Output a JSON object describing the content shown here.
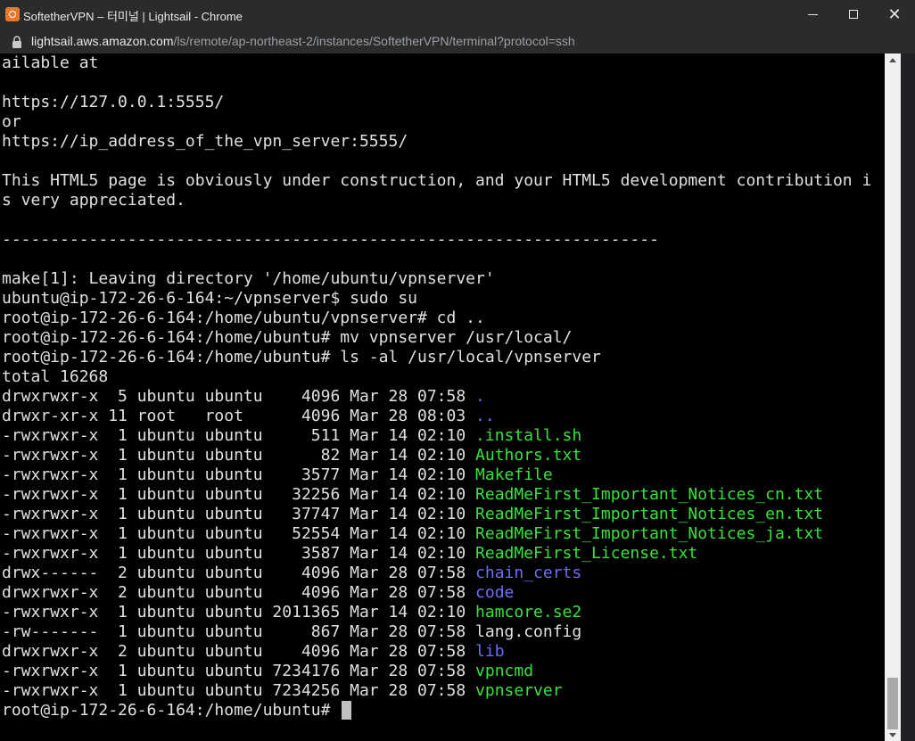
{
  "window": {
    "title": "SoftetherVPN – 터미널 | Lightsail - Chrome",
    "minimize_icon": "minimize-icon",
    "maximize_icon": "maximize-icon",
    "close_symbol": "✕"
  },
  "address": {
    "host": "lightsail.aws.amazon.com",
    "path": "/ls/remote/ap-northeast-2/instances/SoftetherVPN/terminal?protocol=ssh"
  },
  "terminal": {
    "lines": [
      "ailable at",
      "",
      "https://127.0.0.1:5555/",
      "or",
      "https://ip_address_of_the_vpn_server:5555/",
      "",
      "This HTML5 page is obviously under construction, and your HTML5 development contribution i",
      "s very appreciated.",
      "",
      "--------------------------------------------------------------------",
      "",
      "make[1]: Leaving directory '/home/ubuntu/vpnserver'",
      "ubuntu@ip-172-26-6-164:~/vpnserver$ sudo su",
      "root@ip-172-26-6-164:/home/ubuntu/vpnserver# cd ..",
      "root@ip-172-26-6-164:/home/ubuntu# mv vpnserver /usr/local/",
      "root@ip-172-26-6-164:/home/ubuntu# ls -al /usr/local/vpnserver",
      "total 16268"
    ],
    "listing": [
      {
        "prefix": "drwxrwxr-x  5 ubuntu ubuntu    4096 Mar 28 07:58 ",
        "name": ".",
        "kind": "dir"
      },
      {
        "prefix": "drwxr-xr-x 11 root   root      4096 Mar 28 08:03 ",
        "name": "..",
        "kind": "dir"
      },
      {
        "prefix": "-rwxrwxr-x  1 ubuntu ubuntu     511 Mar 14 02:10 ",
        "name": ".install.sh",
        "kind": "exec"
      },
      {
        "prefix": "-rwxrwxr-x  1 ubuntu ubuntu      82 Mar 14 02:10 ",
        "name": "Authors.txt",
        "kind": "exec"
      },
      {
        "prefix": "-rwxrwxr-x  1 ubuntu ubuntu    3577 Mar 14 02:10 ",
        "name": "Makefile",
        "kind": "exec"
      },
      {
        "prefix": "-rwxrwxr-x  1 ubuntu ubuntu   32256 Mar 14 02:10 ",
        "name": "ReadMeFirst_Important_Notices_cn.txt",
        "kind": "exec"
      },
      {
        "prefix": "-rwxrwxr-x  1 ubuntu ubuntu   37747 Mar 14 02:10 ",
        "name": "ReadMeFirst_Important_Notices_en.txt",
        "kind": "exec"
      },
      {
        "prefix": "-rwxrwxr-x  1 ubuntu ubuntu   52554 Mar 14 02:10 ",
        "name": "ReadMeFirst_Important_Notices_ja.txt",
        "kind": "exec"
      },
      {
        "prefix": "-rwxrwxr-x  1 ubuntu ubuntu    3587 Mar 14 02:10 ",
        "name": "ReadMeFirst_License.txt",
        "kind": "exec"
      },
      {
        "prefix": "drwx------  2 ubuntu ubuntu    4096 Mar 28 07:58 ",
        "name": "chain_certs",
        "kind": "dir"
      },
      {
        "prefix": "drwxrwxr-x  2 ubuntu ubuntu    4096 Mar 28 07:58 ",
        "name": "code",
        "kind": "dir"
      },
      {
        "prefix": "-rwxrwxr-x  1 ubuntu ubuntu 2011365 Mar 14 02:10 ",
        "name": "hamcore.se2",
        "kind": "exec"
      },
      {
        "prefix": "-rw-------  1 ubuntu ubuntu     867 Mar 28 07:58 ",
        "name": "lang.config",
        "kind": "plain"
      },
      {
        "prefix": "drwxrwxr-x  2 ubuntu ubuntu    4096 Mar 28 07:58 ",
        "name": "lib",
        "kind": "dir"
      },
      {
        "prefix": "-rwxrwxr-x  1 ubuntu ubuntu 7234176 Mar 28 07:58 ",
        "name": "vpncmd",
        "kind": "exec"
      },
      {
        "prefix": "-rwxrwxr-x  1 ubuntu ubuntu 7234256 Mar 28 07:58 ",
        "name": "vpnserver",
        "kind": "exec"
      }
    ],
    "prompt": "root@ip-172-26-6-164:/home/ubuntu# "
  },
  "colors": {
    "directory": "#6e6ef5",
    "executable": "#37e23d",
    "text": "#e0e0e0",
    "background": "#000000"
  }
}
